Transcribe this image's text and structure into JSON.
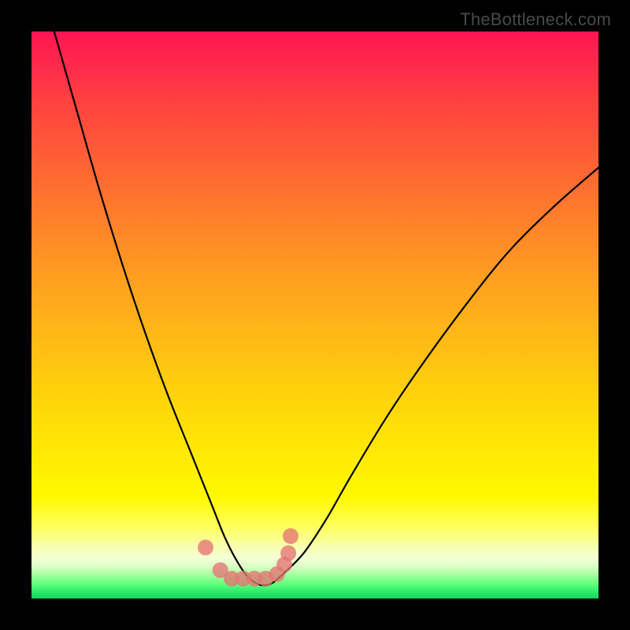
{
  "watermark": "TheBottleneck.com",
  "chart_data": {
    "type": "line",
    "title": "",
    "xlabel": "",
    "ylabel": "",
    "xlim": [
      0,
      100
    ],
    "ylim": [
      0,
      100
    ],
    "grid": false,
    "legend": false,
    "series": [
      {
        "name": "bottleneck-curve",
        "x": [
          4,
          8,
          12,
          16,
          20,
          24,
          28,
          30,
          32,
          34,
          36,
          38,
          40,
          42,
          44,
          48,
          52,
          56,
          62,
          68,
          76,
          84,
          92,
          100
        ],
        "y": [
          100,
          86,
          72,
          59,
          47,
          36,
          26,
          21,
          16,
          11,
          7,
          4,
          2.5,
          2.5,
          4,
          8,
          14,
          21,
          31,
          40,
          51,
          61,
          69,
          76
        ]
      }
    ],
    "points": {
      "name": "cluster-points",
      "x": [
        30.7,
        33.3,
        35.3,
        37.3,
        39.3,
        41.3,
        43.3,
        44.6,
        45.3,
        45.7
      ],
      "y": [
        9.0,
        5.0,
        3.5,
        3.5,
        3.5,
        3.5,
        4.3,
        6.0,
        8.0,
        11.0
      ]
    },
    "gradient_stops": [
      {
        "pos": 0,
        "color": "#ff1452"
      },
      {
        "pos": 50,
        "color": "#ffb418"
      },
      {
        "pos": 82,
        "color": "#fff900"
      },
      {
        "pos": 96,
        "color": "#9cff9a"
      },
      {
        "pos": 100,
        "color": "#18d45e"
      }
    ]
  }
}
